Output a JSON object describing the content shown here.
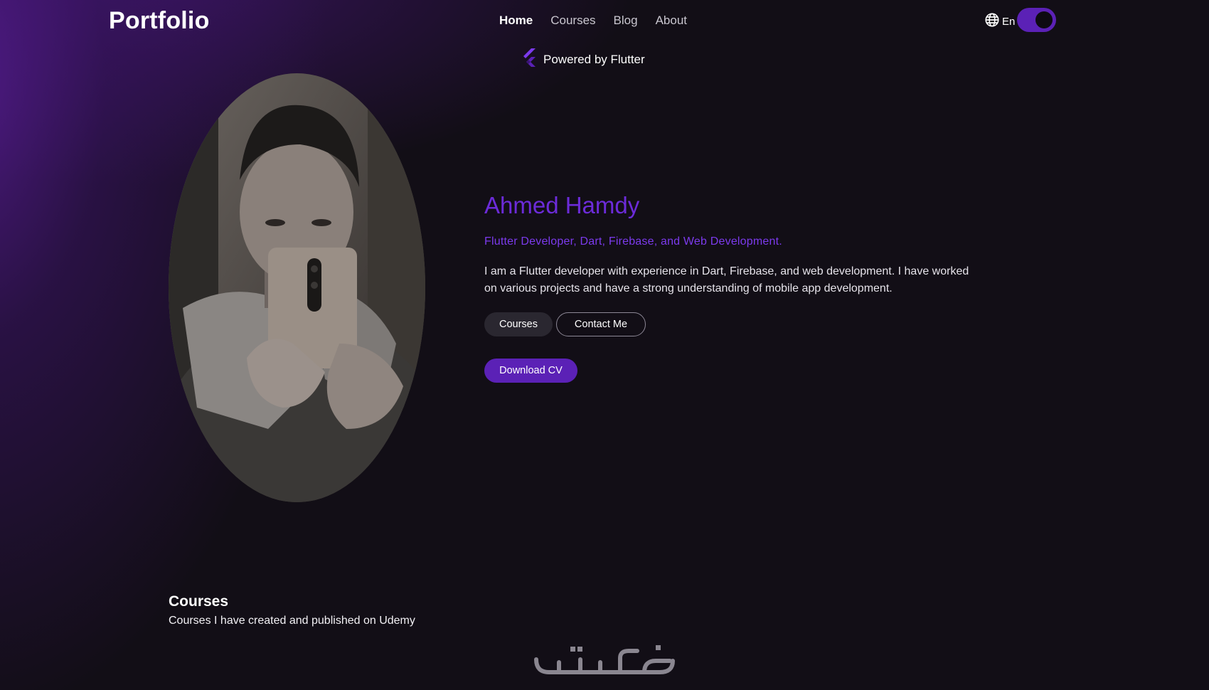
{
  "header": {
    "brand": "Portfolio",
    "nav": [
      {
        "label": "Home",
        "active": true
      },
      {
        "label": "Courses",
        "active": false
      },
      {
        "label": "Blog",
        "active": false
      },
      {
        "label": "About",
        "active": false
      }
    ],
    "language_icon": "globe-icon",
    "language_label": "En",
    "theme_toggle_on": true
  },
  "powered_by": {
    "icon": "flutter-logo-icon",
    "label": "Powered by Flutter"
  },
  "hero": {
    "name": "Ahmed Hamdy",
    "tagline": "Flutter Developer, Dart, Firebase, and Web Development.",
    "bio": "I am a Flutter developer with experience in Dart, Firebase, and web development. I have worked on various projects and have a strong understanding of mobile app development.",
    "courses_button": "Courses",
    "contact_button": "Contact Me",
    "download_button": "Download CV"
  },
  "courses_section": {
    "title": "Courses",
    "subtitle": "Courses I have created and published on Udemy"
  },
  "watermark": "خمسات",
  "colors": {
    "background": "#120e16",
    "accent": "#5b21b6",
    "name": "#6c2bd9",
    "tagline": "#7c3aed"
  }
}
